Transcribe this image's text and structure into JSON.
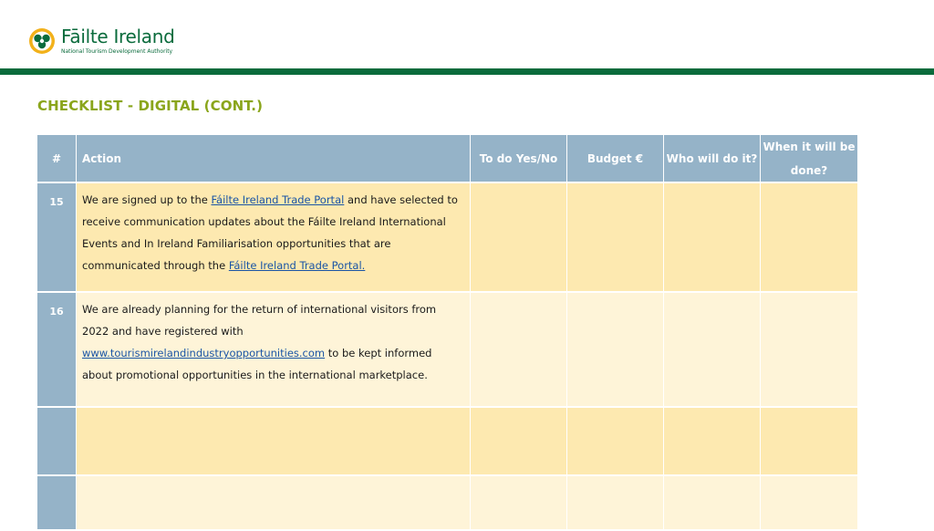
{
  "header": {
    "logo_name": "Fāilte Ireland",
    "logo_tagline": "National Tourism Development Authority"
  },
  "page_title": "CHECKLIST - DIGITAL (CONT.)",
  "table": {
    "columns": [
      "#",
      "Action",
      "To do  Yes/No",
      "Budget €",
      "Who will do it?",
      "When it will be done?"
    ],
    "rows": [
      {
        "num": "15",
        "action": [
          {
            "text": "We are signed up to the "
          },
          {
            "link": "Fáilte Ireland Trade Portal"
          },
          {
            "text": " and have selected to receive communication updates about the Fáilte Ireland International Events and In Ireland Familiarisation opportunities that are communicated through the "
          },
          {
            "link": "Fáilte Ireland Trade Portal."
          }
        ]
      },
      {
        "num": "16",
        "action": [
          {
            "text": "We are already planning for the return of international visitors from 2022 and have registered with "
          },
          {
            "link": "www.tourismirelandindustryopportunities.com"
          },
          {
            "text": " to be kept informed about promotional opportunities in the international marketplace."
          }
        ]
      },
      {
        "num": "",
        "action": []
      },
      {
        "num": "",
        "action": []
      }
    ]
  },
  "colors": {
    "brand_green": "#0a6b3c",
    "title_green": "#8aa51b",
    "header_blue": "#95b3c8",
    "row_yellow_dark": "#fde9b0",
    "row_yellow_light": "#fef4d8",
    "link_blue": "#1a55a5"
  }
}
